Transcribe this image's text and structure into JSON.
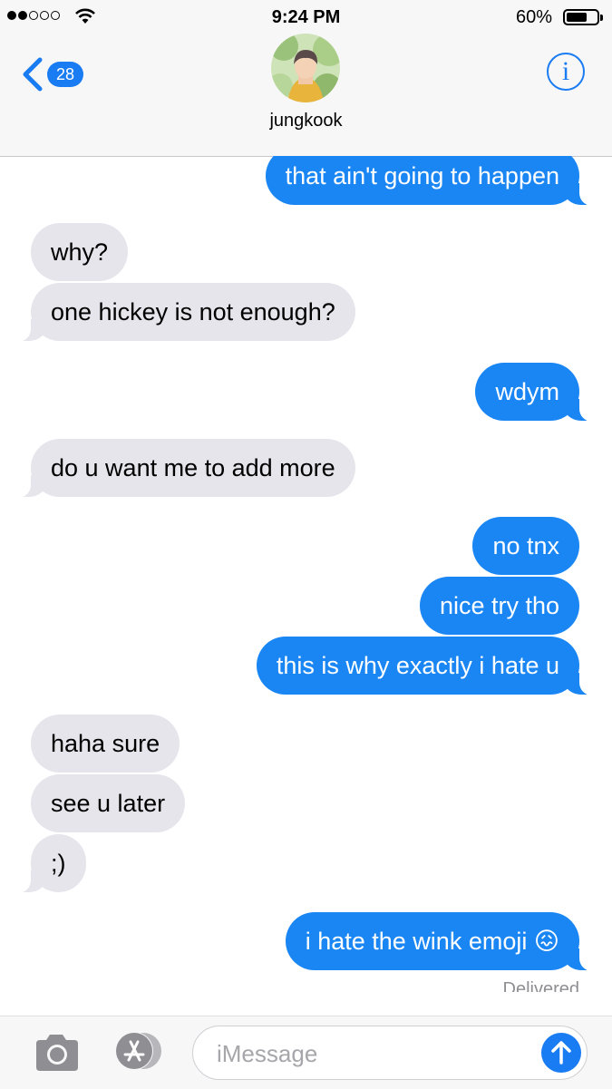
{
  "status_bar": {
    "time": "9:24 PM",
    "battery_percent": "60%",
    "battery_level": 0.6,
    "signal_bars_filled": 2,
    "signal_bars_total": 5
  },
  "header": {
    "back_count": "28",
    "contact_name": "jungkook",
    "info_glyph": "i",
    "icons": [
      "chevron-left-icon",
      "info-icon"
    ]
  },
  "messages": [
    {
      "side": "out",
      "text": "that ain't going to happen"
    },
    {
      "side": "in",
      "text": "why?"
    },
    {
      "side": "in",
      "text": "one hickey is not enough?"
    },
    {
      "side": "out",
      "text": "wdym"
    },
    {
      "side": "in",
      "text": "do u want me to add more"
    },
    {
      "side": "out",
      "text": "no tnx"
    },
    {
      "side": "out",
      "text": "nice try tho"
    },
    {
      "side": "out",
      "text": "this is why exactly i hate u"
    },
    {
      "side": "in",
      "text": "haha sure"
    },
    {
      "side": "in",
      "text": "see u later"
    },
    {
      "side": "in",
      "text": ";)"
    },
    {
      "side": "out",
      "text": "i hate the wink emoji 😖"
    }
  ],
  "delivered_label": "Delivered",
  "input_bar": {
    "placeholder": "iMessage",
    "icons": [
      "camera-icon",
      "app-store-icon",
      "send-arrow-icon"
    ]
  },
  "colors": {
    "outgoing_bubble": "#1a86f4",
    "incoming_bubble": "#e6e5eb",
    "accent": "#1a7cf3",
    "secondary_text": "#8e8e93"
  }
}
